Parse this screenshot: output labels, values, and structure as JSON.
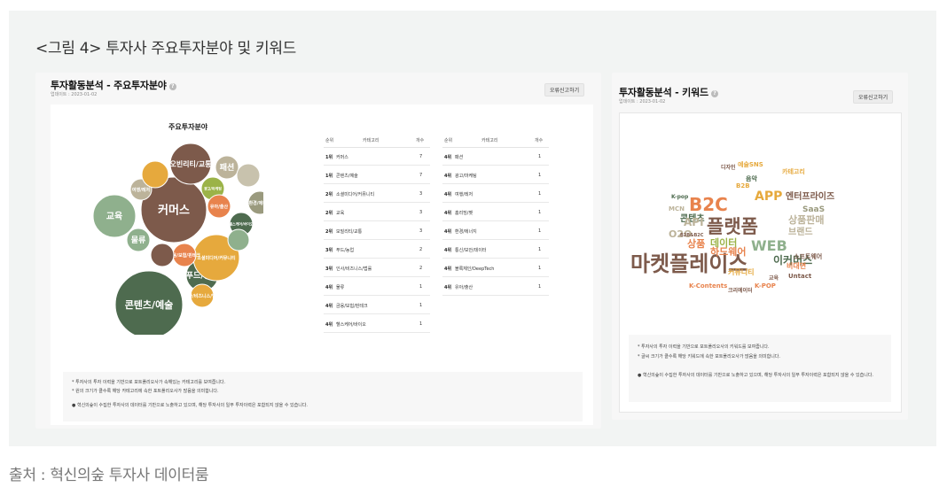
{
  "figure_title": "<그림 4> 투자사 주요투자분야 및 키워드",
  "source": "출처 : 혁신의숲 투자사 데이터룸",
  "panel_focus": {
    "title": "투자활동분석 - 주요투자분야",
    "date": "업데이트 : 2023-01-02",
    "button": "오류신고하기",
    "chart_title": "주요투자분야",
    "bubbles": [
      {
        "label": "커머스",
        "color": "#7d5a4b"
      },
      {
        "label": "콘텐츠/예술",
        "color": "#4e6b4f"
      },
      {
        "label": "교육",
        "color": "#8fb08d"
      },
      {
        "label": "오빈리티/교통",
        "color": "#7d5a4b"
      },
      {
        "label": "패션",
        "color": "#bcb39a"
      },
      {
        "label": "푸드/농업",
        "color": "#4e6b4f"
      },
      {
        "label": "소셜미디어/커뮤니티",
        "color": "#e6a93d"
      },
      {
        "label": "물류",
        "color": "#8fb08d"
      },
      {
        "label": "광고/마케팅",
        "color": "#9bb348"
      },
      {
        "label": "유아/출산",
        "color": "#e8834d"
      },
      {
        "label": "인사/비즈니스/법률",
        "color": "#e6a93d"
      },
      {
        "label": "여행/레저",
        "color": "#bcb39a"
      },
      {
        "label": "환경/에너지",
        "color": "#9a9a7e"
      },
      {
        "label": "헬스케어/바이오",
        "color": "#4e6b4f"
      },
      {
        "label": "금융/보험/핀테크",
        "color": "#e8834d"
      },
      {
        "label": "",
        "color": "#c8c2ad"
      },
      {
        "label": "",
        "color": "#7d5a4b"
      },
      {
        "label": "",
        "color": "#e6a93d"
      },
      {
        "label": "",
        "color": "#8fb08d"
      },
      {
        "label": "",
        "color": "#bcb39a"
      }
    ],
    "table_headers": {
      "rank": "순위",
      "category": "카테고리",
      "count": "개수"
    },
    "table_left": [
      {
        "rank": "1위",
        "category": "커머스",
        "count": "7"
      },
      {
        "rank": "1위",
        "category": "콘텐츠/예술",
        "count": "7"
      },
      {
        "rank": "2위",
        "category": "소셜미디어/커뮤니티",
        "count": "3"
      },
      {
        "rank": "2위",
        "category": "교육",
        "count": "3"
      },
      {
        "rank": "2위",
        "category": "모빌리티/교통",
        "count": "3"
      },
      {
        "rank": "3위",
        "category": "푸드/농업",
        "count": "2"
      },
      {
        "rank": "3위",
        "category": "인사/비즈니스/법률",
        "count": "2"
      },
      {
        "rank": "4위",
        "category": "물류",
        "count": "1"
      },
      {
        "rank": "4위",
        "category": "금융/보험/핀테크",
        "count": "1"
      },
      {
        "rank": "4위",
        "category": "헬스케어/바이오",
        "count": "1"
      }
    ],
    "table_right": [
      {
        "rank": "4위",
        "category": "패션",
        "count": "1"
      },
      {
        "rank": "4위",
        "category": "광고/마케팅",
        "count": "1"
      },
      {
        "rank": "4위",
        "category": "여행/레저",
        "count": "1"
      },
      {
        "rank": "4위",
        "category": "홈리빙/펫",
        "count": "1"
      },
      {
        "rank": "4위",
        "category": "환경/에너지",
        "count": "1"
      },
      {
        "rank": "4위",
        "category": "통신/보안/데이터",
        "count": "1"
      },
      {
        "rank": "4위",
        "category": "블록체인/DeepTech",
        "count": "1"
      },
      {
        "rank": "4위",
        "category": "유아/출산",
        "count": "1"
      }
    ],
    "notes": [
      "* 투자사의 투자 이력을 기반으로 포트폴리오사가 속해있는 카테고리를 보여줍니다.",
      "* 원의 크기가 클수록 해당 카테고리에 속한 포트폴리오사가 많음을 의미합니다.",
      "혁신의숲이 수집한 투자사의 데이터를 기반으로 노출하고 있으며, 해당 투자사의 일부 투자이력은 포함되지 않을 수 있습니다."
    ]
  },
  "panel_keywords": {
    "title": "투자활동분석 - 키워드",
    "date": "업데이트 : 2023-01-02",
    "button": "오류신고하기",
    "words": [
      {
        "text": "마켓플레이스",
        "color": "#7d5a4b"
      },
      {
        "text": "플랫폼",
        "color": "#7d5a4b"
      },
      {
        "text": "B2C",
        "color": "#e8834d"
      },
      {
        "text": "APP",
        "color": "#e6a93d"
      },
      {
        "text": "WEB",
        "color": "#8fb08d"
      },
      {
        "text": "이커머스",
        "color": "#4e6b4f"
      },
      {
        "text": "하드웨어",
        "color": "#e8834d"
      },
      {
        "text": "엔터프라이즈",
        "color": "#7d5a4b"
      },
      {
        "text": "상품판매",
        "color": "#bcb39a"
      },
      {
        "text": "콘텐츠",
        "color": "#4e6b4f"
      },
      {
        "text": "브랜드",
        "color": "#bcb39a"
      },
      {
        "text": "SaaS",
        "color": "#9a9a7e"
      },
      {
        "text": "API",
        "color": "#bcb39a"
      },
      {
        "text": "O2O",
        "color": "#bcb39a"
      },
      {
        "text": "상품",
        "color": "#e8834d"
      },
      {
        "text": "데이터",
        "color": "#9bb348"
      },
      {
        "text": "소프트웨어",
        "color": "#7d5a4b"
      },
      {
        "text": "K-Contents",
        "color": "#e8834d"
      },
      {
        "text": "K-POP",
        "color": "#e8834d"
      },
      {
        "text": "Untact",
        "color": "#7d5a4b"
      },
      {
        "text": "B2B&B2C",
        "color": "#7d5a4b"
      },
      {
        "text": "커뮤니티",
        "color": "#e6a93d"
      },
      {
        "text": "B2B",
        "color": "#e6a93d"
      },
      {
        "text": "MCN",
        "color": "#bcb39a"
      },
      {
        "text": "K-pop",
        "color": "#4e6b4f"
      },
      {
        "text": "디자인",
        "color": "#7d5a4b"
      },
      {
        "text": "교육",
        "color": "#7d5a4b"
      },
      {
        "text": "비대면",
        "color": "#e8834d"
      },
      {
        "text": "크리에이터",
        "color": "#7d5a4b"
      },
      {
        "text": "음악",
        "color": "#4e6b4f"
      },
      {
        "text": "카테고리",
        "color": "#e6a93d"
      },
      {
        "text": "예술SNS",
        "color": "#e6a93d"
      }
    ],
    "notes": [
      "* 투자사의 투자 이력을 기반으로 포트폴리오사의 키워드를 보여줍니다.",
      "* 글씨 크기가 클수록 해당 키워드에 속한 포트폴리오사가 많음을 의미합니다.",
      "혁신의숲이 수집한 투자사의 데이터를 기반으로 노출하고 있으며, 해당 투자사의 일부 투자이력은 포함되지 않을 수 있습니다."
    ]
  }
}
